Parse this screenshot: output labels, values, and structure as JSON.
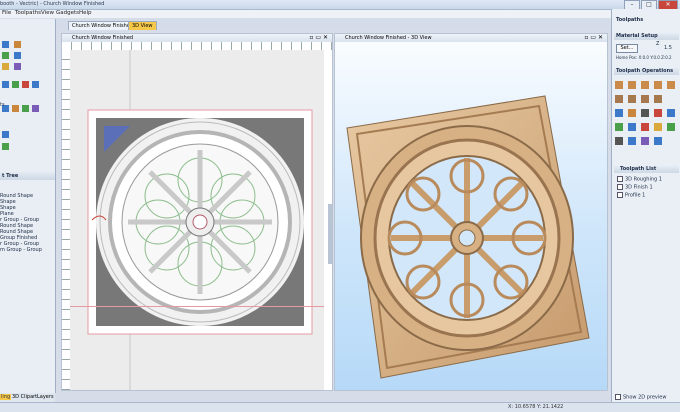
{
  "window": {
    "title": "booth - Vectric) - Church Window Finished",
    "controls": [
      "–",
      "□",
      "✕"
    ]
  },
  "menu": [
    "File",
    "Toolpaths",
    "View",
    "Gadgets",
    "Help"
  ],
  "left_panel": {
    "section_partial_labels": [
      "ts"
    ],
    "tree_header": "t Tree",
    "tree_items": [
      "Round Shape",
      "Shape",
      "Shape",
      "Plane",
      "r Group - Group",
      "Round Shape",
      "Round Shape",
      "Group Finished",
      "r Group - Group",
      "m Group - Group"
    ],
    "bottom_tabs": [
      "ling",
      "3D Clipart",
      "Layers"
    ]
  },
  "doc_tabs": [
    "Church Window Finished",
    "3D View"
  ],
  "view2d": {
    "title": "Church Window Finished"
  },
  "view3d": {
    "title": "Church Window Finished - 3D View"
  },
  "right_panel": {
    "title": "Toolpaths",
    "material_setup": {
      "label": "Material Setup",
      "button": "Set...",
      "z_label": "Z",
      "z_value": "1.5",
      "home_pos": "Home Pos: X:0.0 Y:0.0 Z:0.2"
    },
    "toolpath_operations": "Toolpath Operations",
    "toolpath_list": {
      "title": "Toolpath List",
      "items": [
        "3D Roughing 1",
        "3D Finish 1",
        "Profile 1"
      ]
    },
    "show_2d_preview": "Show 2D preview"
  },
  "status": {
    "coords": "X: 10.6578 Y: 21.1422"
  },
  "colors": {
    "accent_tab": "#f6c84a",
    "wood": "#d9b58e",
    "sky": "#cfe6fa"
  }
}
